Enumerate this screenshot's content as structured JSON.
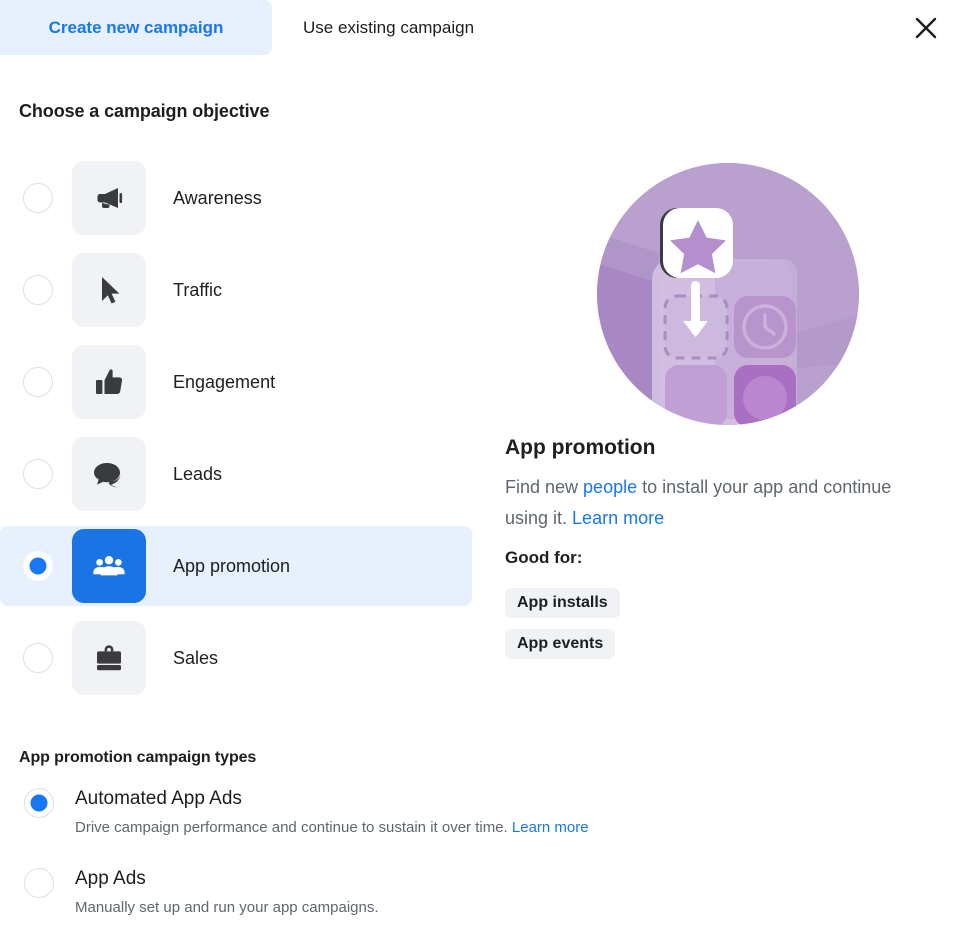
{
  "header": {
    "tabs": [
      {
        "label": "Create new campaign",
        "active": true
      },
      {
        "label": "Use existing campaign",
        "active": false
      }
    ],
    "close_icon": "close-icon"
  },
  "objective_section": {
    "title": "Choose a campaign objective",
    "items": [
      {
        "label": "Awareness",
        "icon": "megaphone-icon",
        "selected": false
      },
      {
        "label": "Traffic",
        "icon": "cursor-icon",
        "selected": false
      },
      {
        "label": "Engagement",
        "icon": "thumbs-up-icon",
        "selected": false
      },
      {
        "label": "Leads",
        "icon": "chat-bubbles-icon",
        "selected": false
      },
      {
        "label": "App promotion",
        "icon": "people-group-icon",
        "selected": true
      },
      {
        "label": "Sales",
        "icon": "briefcase-icon",
        "selected": false
      }
    ]
  },
  "detail_panel": {
    "illustration": "app-promotion-illustration",
    "title": "App promotion",
    "description_part1": "Find new ",
    "description_link1": "people",
    "description_part2": " to install your app and continue using it. ",
    "description_link2": "Learn more",
    "good_for_label": "Good for:",
    "badges": [
      "App installs",
      "App events"
    ]
  },
  "types_section": {
    "title": "App promotion campaign types",
    "options": [
      {
        "label": "Automated App Ads",
        "description": "Drive campaign performance and continue to sustain it over time. ",
        "link": "Learn more",
        "selected": true
      },
      {
        "label": "App Ads",
        "description": "Manually set up and run your app campaigns.",
        "link": "",
        "selected": false
      }
    ]
  },
  "colors": {
    "accent_blue": "#1877f2",
    "tile_blue": "#1b74e4",
    "selected_row_bg": "#e7f0fd",
    "tile_gray": "#f0f2f5",
    "text_primary": "#1c1e21",
    "text_secondary": "#606770",
    "illustration_purple": "#b9a0ce"
  }
}
